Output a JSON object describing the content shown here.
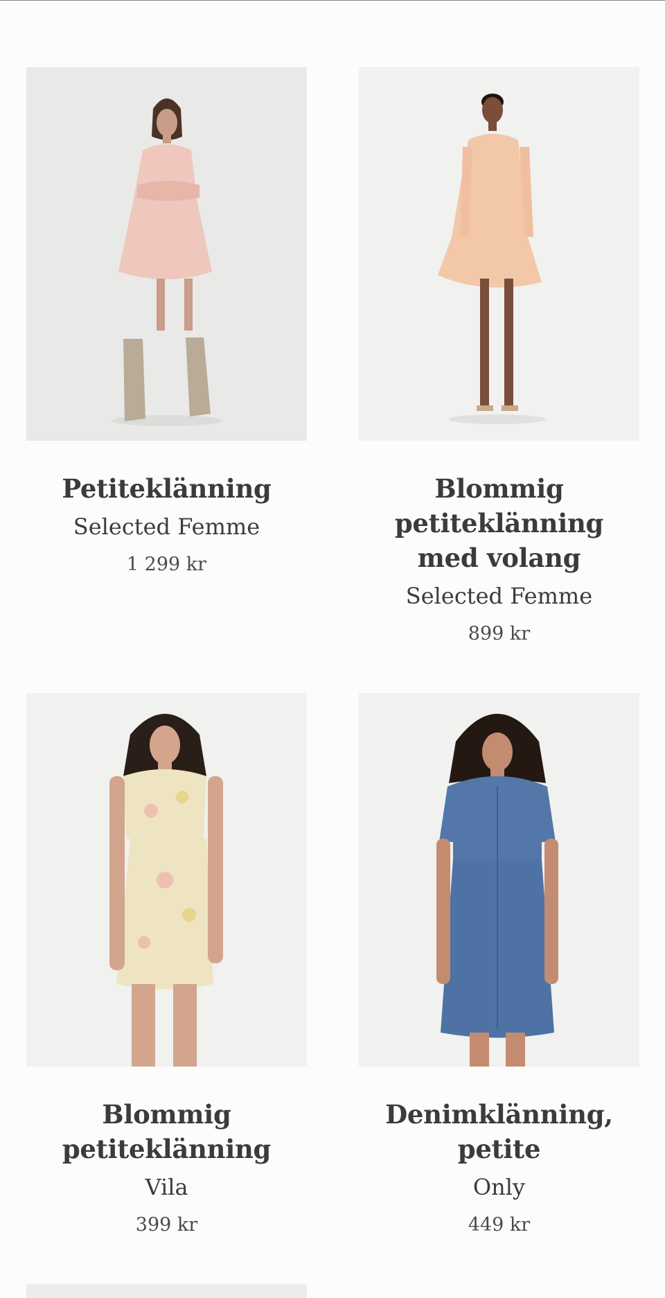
{
  "products": [
    {
      "title": "Petiteklänning",
      "brand": "Selected Femme",
      "price": "1 299 kr",
      "image": "model-blush-tiered-dress-boots",
      "colors": {
        "dress": "#efc7bc",
        "skin": "#c99d88",
        "hair": "#4a3226",
        "shoes": "#b9ab98"
      }
    },
    {
      "title": "Blommig petiteklänning med volang",
      "brand": "Selected Femme",
      "price": "899 kr",
      "image": "model-peach-floral-dress-sandals",
      "colors": {
        "dress": "#f2c8a8",
        "skin": "#7a4e38",
        "hair": "#1c1411",
        "shoes": "#c7a98a"
      }
    },
    {
      "title": "Blommig petiteklänning",
      "brand": "Vila",
      "price": "399 kr",
      "image": "model-yellow-floral-wrap-dress",
      "colors": {
        "dress": "#eee4c2",
        "skin": "#d2a58c",
        "hair": "#2a1e19",
        "shoes": "#d2a58c"
      }
    },
    {
      "title": "Denimklänning, petite",
      "brand": "Only",
      "price": "449 kr",
      "image": "model-blue-denim-shirt-dress",
      "colors": {
        "dress": "#5277a8",
        "skin": "#c38c70",
        "hair": "#241812",
        "shoes": "#c38c70"
      }
    }
  ]
}
